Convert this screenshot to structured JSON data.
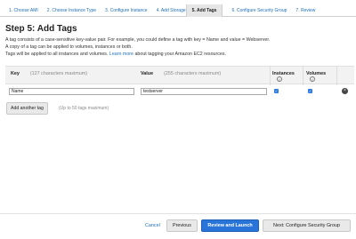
{
  "wizard": {
    "steps": [
      {
        "label": "1. Choose AMI"
      },
      {
        "label": "2. Choose Instance Type"
      },
      {
        "label": "3. Configure Instance"
      },
      {
        "label": "4. Add Storage"
      },
      {
        "label": "5. Add Tags"
      },
      {
        "label": "6. Configure Security Group"
      },
      {
        "label": "7. Review"
      }
    ],
    "active_step": "5. Add Tags"
  },
  "page": {
    "title": "Step 5: Add Tags",
    "desc_line1": "A tag consists of a case-sensitive key-value pair. For example, you could define a tag with key = Name and value = Webserver.",
    "desc_line2": "A copy of a tag can be applied to volumes, instances or both.",
    "desc_line3_prefix": "Tags will be applied to all instances and volumes.",
    "learn_more": "Learn more",
    "desc_line3_suffix": "about tagging your Amazon EC2 resources."
  },
  "table": {
    "headers": {
      "key": "Key",
      "key_hint": "(127 characters maximum)",
      "value": "Value",
      "value_hint": "(255 characters maximum)",
      "instances": "Instances",
      "volumes": "Volumes"
    },
    "rows": [
      {
        "key": "Name",
        "value": "testserver",
        "instances": true,
        "volumes": true
      }
    ]
  },
  "actions": {
    "add_tag": "Add another tag",
    "add_tag_hint": "(Up to 50 tags maximum)"
  },
  "footer": {
    "cancel": "Cancel",
    "previous": "Previous",
    "review_launch": "Review and Launch",
    "next": "Next: Configure Security Group"
  },
  "colors": {
    "link": "#1f6fb5",
    "primary_button": "#2874d8",
    "header_bg": "#f2f2f2"
  }
}
